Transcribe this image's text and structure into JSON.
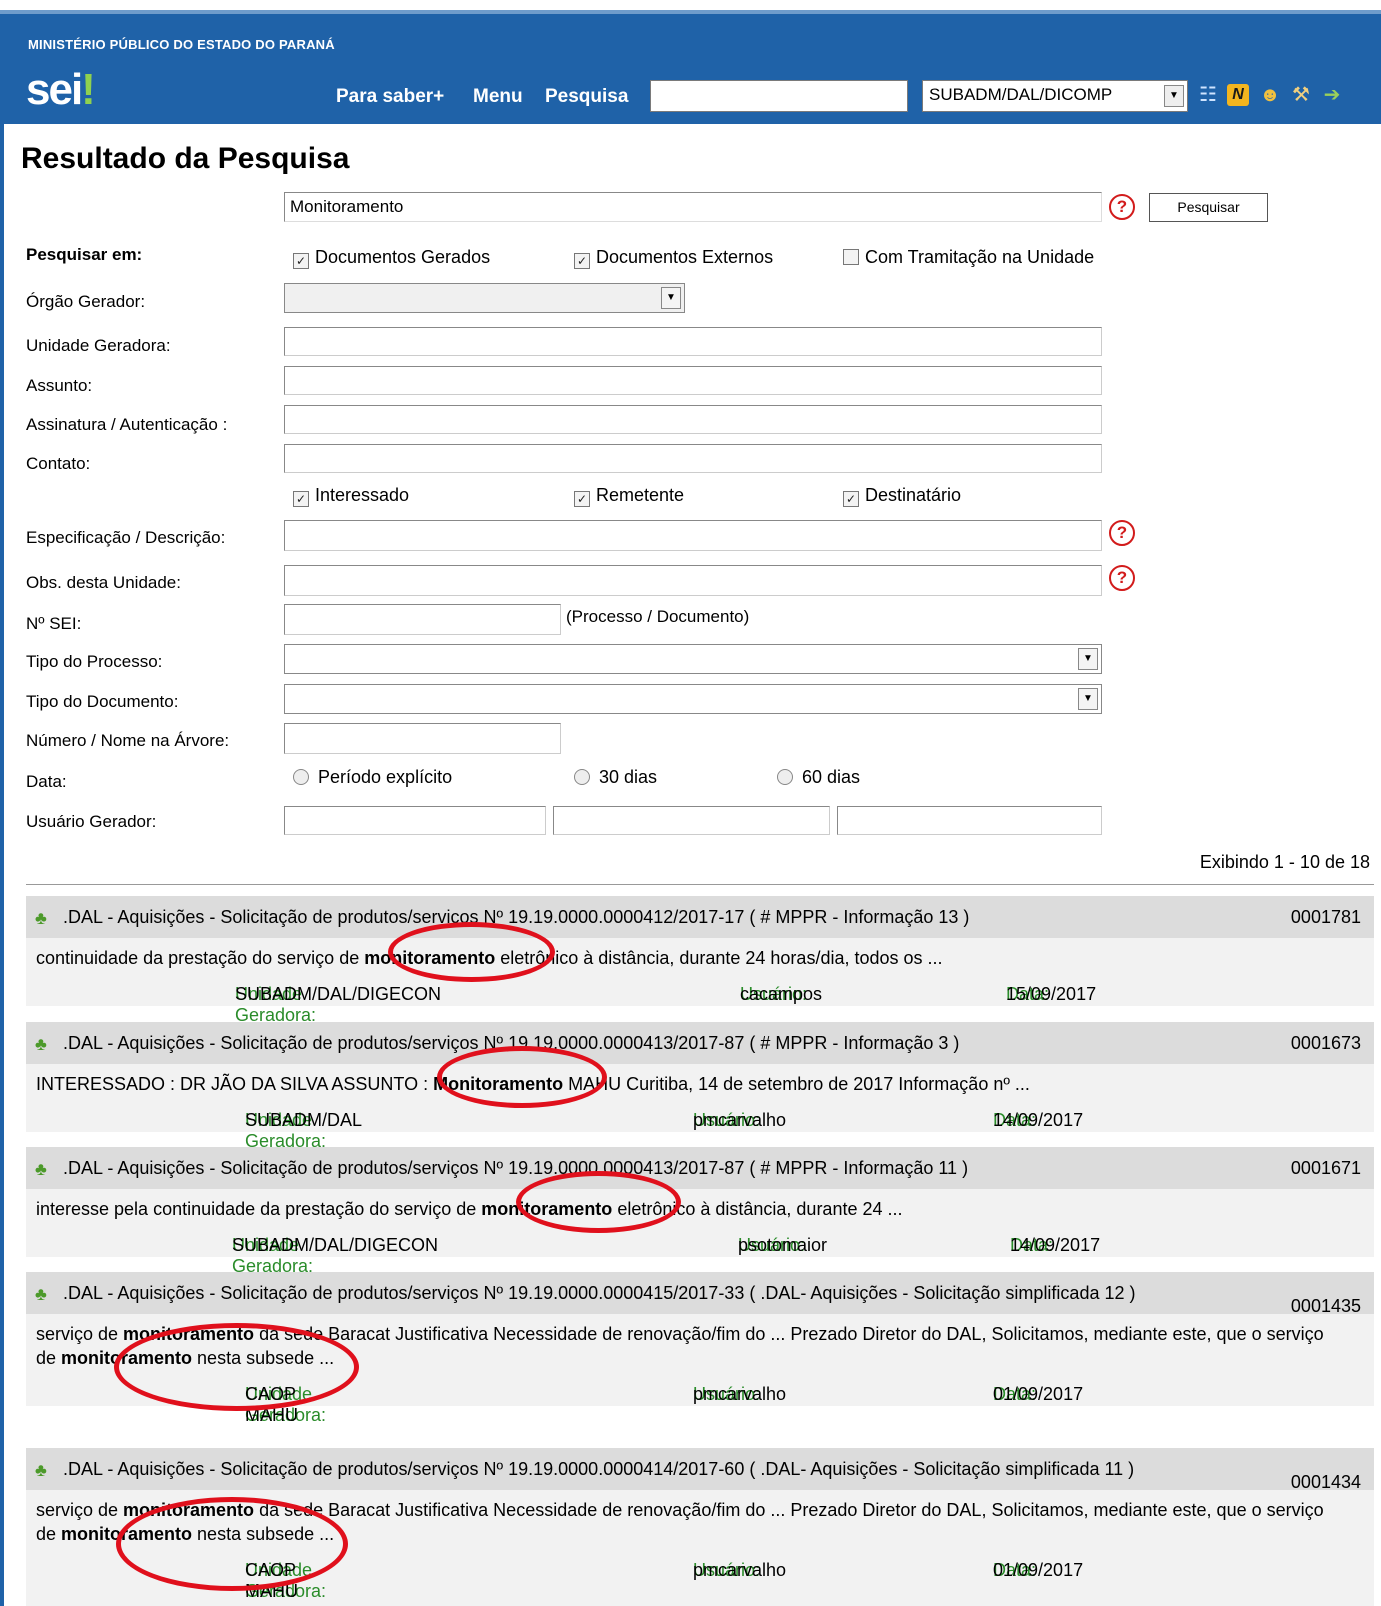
{
  "header": {
    "org": "MINISTÉRIO PÚBLICO DO ESTADO DO PARANÁ",
    "logo": "sei",
    "logo_mark": "!",
    "links": [
      "Para saber+",
      "Menu",
      "Pesquisa"
    ],
    "search_value": "",
    "unit": "SUBADM/DAL/DICOMP",
    "icons": [
      "list-icon",
      "notes-icon",
      "user-icon",
      "wrench-icon",
      "exit-icon"
    ]
  },
  "page": {
    "title": "Resultado da Pesquisa",
    "search_value": "Monitoramento",
    "search_button": "Pesquisar",
    "help_glyph": "?"
  },
  "form": {
    "search_in_label": "Pesquisar em:",
    "search_in": [
      {
        "label": "Documentos Gerados",
        "checked": true
      },
      {
        "label": "Documentos Externos",
        "checked": true
      },
      {
        "label": "Com Tramitação na Unidade",
        "checked": false
      }
    ],
    "orgao_label": "Órgão Gerador:",
    "unidade_label": "Unidade Geradora:",
    "assunto_label": "Assunto:",
    "assinatura_label": "Assinatura / Autenticação :",
    "contato_label": "Contato:",
    "contato_opts": [
      {
        "label": "Interessado",
        "checked": true
      },
      {
        "label": "Remetente",
        "checked": true
      },
      {
        "label": "Destinatário",
        "checked": true
      }
    ],
    "especificacao_label": "Especificação / Descrição:",
    "obs_label": "Obs. desta Unidade:",
    "nsei_label": "Nº SEI:",
    "nsei_hint": "(Processo / Documento)",
    "tipo_proc_label": "Tipo do Processo:",
    "tipo_doc_label": "Tipo do Documento:",
    "numero_label": "Número / Nome na Árvore:",
    "data_label": "Data:",
    "data_opts": [
      "Período explícito",
      "30 dias",
      "60 dias"
    ],
    "usuario_label": "Usuário Gerador:"
  },
  "results": {
    "count_text": "Exibindo 1 - 10 de 18",
    "meta_labels": {
      "unidade": "Unidade Geradora:",
      "usuario": "Usuário:",
      "data": "Data:"
    },
    "items": [
      {
        "title": ".DAL - Aquisições - Solicitação de produtos/serviços Nº 19.19.0000.0000412/2017-17 ( # MPPR - Informação 13 )",
        "number": "0001781",
        "snippet": [
          "continuidade da prestação do serviço de ",
          "monitoramento",
          " eletrônico à distância, durante 24 horas/dia, todos os ..."
        ],
        "unidade": "SUBADM/DAL/DIGECON",
        "usuario": "cacampos",
        "data": "15/09/2017"
      },
      {
        "title": ".DAL - Aquisições - Solicitação de produtos/serviços Nº 19.19.0000.0000413/2017-87 ( # MPPR - Informação 3 )",
        "number": "0001673",
        "snippet": [
          "INTERESSADO : DR JÃO DA SILVA ASSUNTO : ",
          "Monitoramento",
          " MAHU Curitiba, 14 de setembro de 2017 Informação nº ..."
        ],
        "unidade": "SUBADM/DAL",
        "usuario": "pmcarvalho",
        "data": "14/09/2017"
      },
      {
        "title": ".DAL - Aquisições - Solicitação de produtos/serviços Nº 19.19.0000.0000413/2017-87 ( # MPPR - Informação 11 )",
        "number": "0001671",
        "snippet": [
          "interesse pela continuidade da prestação do serviço de ",
          "monitoramento",
          " eletrônico à distância, durante 24 ..."
        ],
        "unidade": "SUBADM/DAL/DIGECON",
        "usuario": "psotomaior",
        "data": "14/09/2017"
      },
      {
        "title": ".DAL - Aquisições - Solicitação de produtos/serviços Nº 19.19.0000.0000415/2017-33 ( .DAL- Aquisições - Solicitação simplificada 12 )",
        "number": "0001435",
        "snippet": [
          "serviço de ",
          "monitoramento",
          " da sede Baracat Justificativa Necessidade de renovação/fim do ...  Prezado Diretor do DAL, Solicitamos, mediante este, que o serviço de ",
          "monitoramento",
          " nesta subsede ..."
        ],
        "unidade": "CAOP MAHU",
        "usuario": "pmcarvalho",
        "data": "01/09/2017"
      },
      {
        "title": ".DAL - Aquisições - Solicitação de produtos/serviços Nº 19.19.0000.0000414/2017-60 ( .DAL- Aquisições - Solicitação simplificada 11 )",
        "number": "0001434",
        "snippet": [
          "serviço de ",
          "monitoramento",
          " da sede Baracat Justificativa Necessidade de renovação/fim do ...  Prezado Diretor do DAL, Solicitamos, mediante este, que o serviço de ",
          "monitoramento",
          " nesta subsede ..."
        ],
        "unidade": "CAOP MAHU",
        "usuario": "pmcarvalho",
        "data": "01/09/2017"
      }
    ]
  },
  "colors": {
    "header_bg": "#1f62a8",
    "accent_green": "#2a8c2a",
    "annotation_red": "#e0101c"
  }
}
